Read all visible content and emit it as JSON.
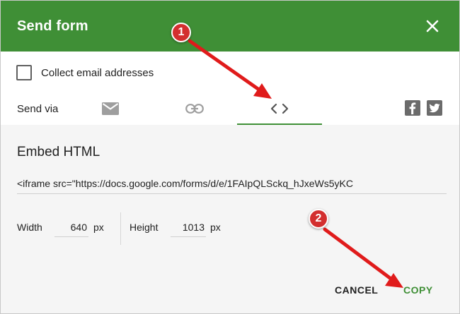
{
  "dialog": {
    "title": "Send form",
    "close_icon": "close-icon"
  },
  "collect": {
    "label": "Collect email addresses",
    "checked": false
  },
  "send_via": {
    "label": "Send via",
    "tabs": [
      {
        "icon": "email-icon",
        "selected": false
      },
      {
        "icon": "link-icon",
        "selected": false
      },
      {
        "icon": "embed-code-icon",
        "selected": true
      }
    ],
    "social": [
      {
        "icon": "facebook-icon"
      },
      {
        "icon": "twitter-icon"
      }
    ]
  },
  "embed": {
    "title": "Embed HTML",
    "code": "<iframe src=\"https://docs.google.com/forms/d/e/1FAIpQLSckq_hJxeWs5yKC",
    "width_label": "Width",
    "width_value": "640",
    "width_unit": "px",
    "height_label": "Height",
    "height_value": "1013",
    "height_unit": "px"
  },
  "actions": {
    "cancel": "CANCEL",
    "copy": "COPY"
  },
  "annotations": {
    "step1": "1",
    "step2": "2"
  },
  "colors": {
    "header": "#3f8f36",
    "accent": "#3f8f36",
    "annotation": "#e01b1b"
  }
}
